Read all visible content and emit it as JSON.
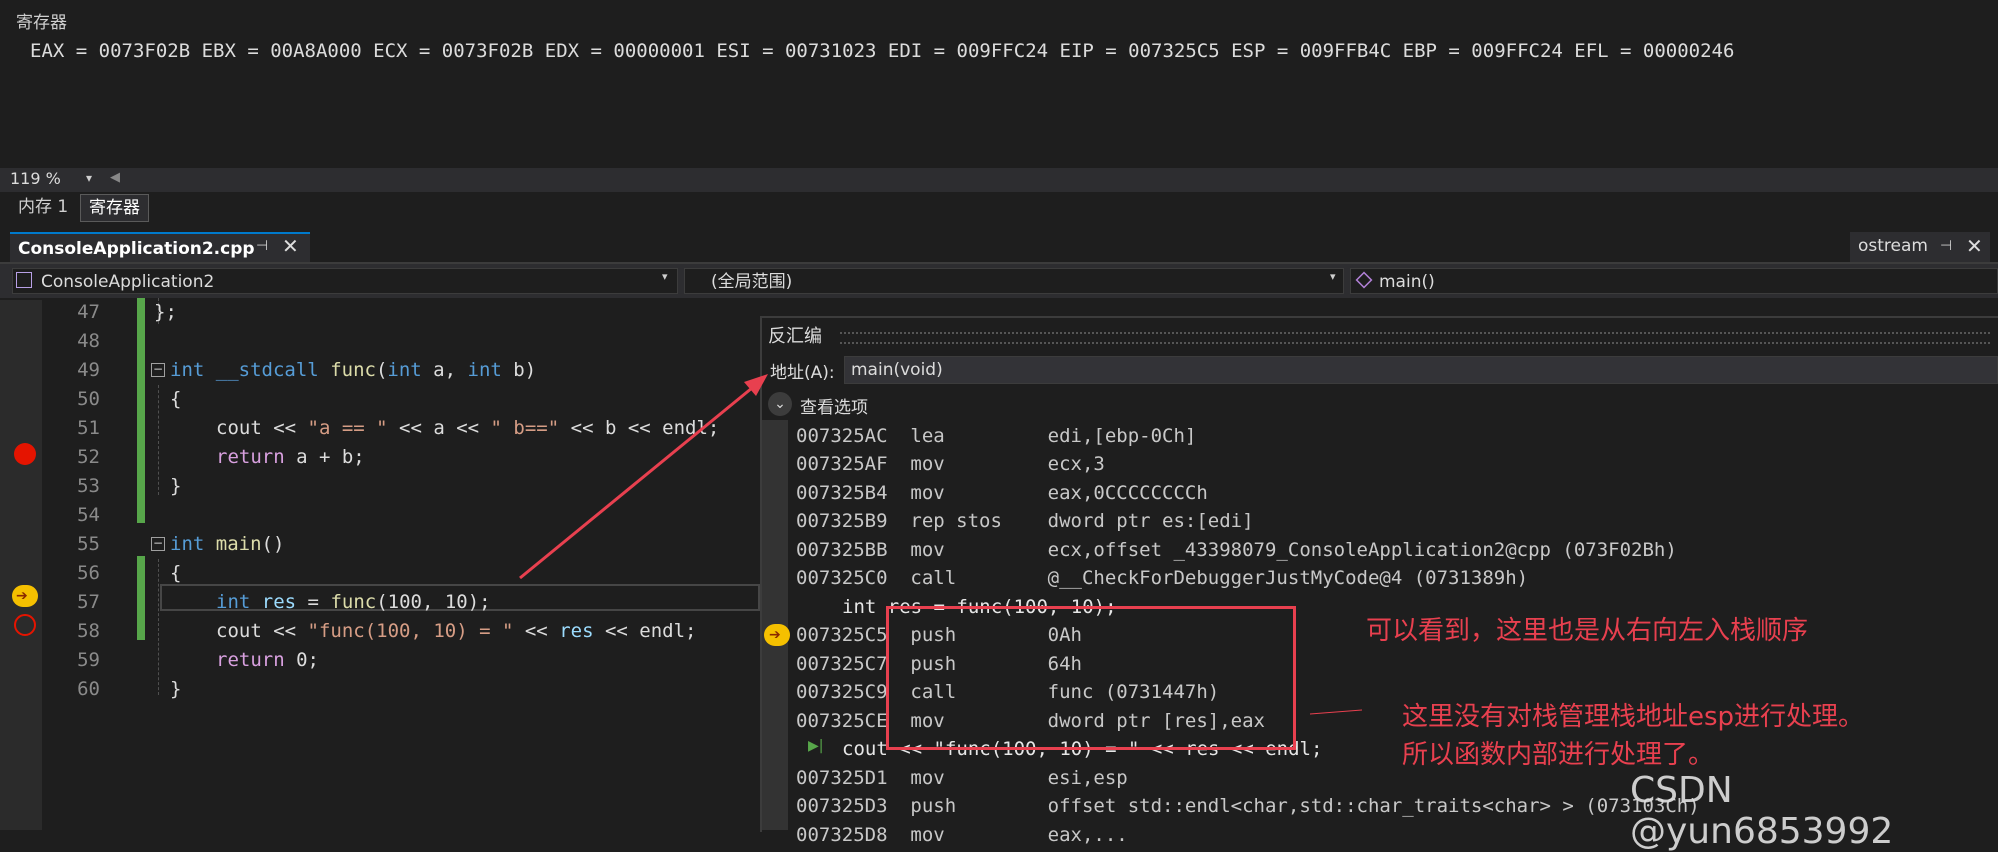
{
  "registers": {
    "title": "寄存器",
    "line": "EAX = 0073F02B EBX = 00A8A000 ECX = 0073F02B EDX = 00000001 ESI = 00731023 EDI = 009FFC24 EIP = 007325C5 ESP = 009FFB4C EBP = 009FFC24 EFL = 00000246",
    "zoom": "119 %"
  },
  "bottom_tabs": [
    "内存 1",
    "寄存器"
  ],
  "doc_tab": {
    "label": "ConsoleApplication2.cpp",
    "pin": "⊣",
    "close": "✕"
  },
  "side_tab": {
    "label": "ostream",
    "pin": "⊣",
    "close": "✕"
  },
  "nav": {
    "project": "ConsoleApplication2",
    "scope": "(全局范围)",
    "function": "main()"
  },
  "line_numbers": [
    "47",
    "48",
    "49",
    "50",
    "51",
    "52",
    "53",
    "54",
    "55",
    "56",
    "57",
    "58",
    "59",
    "60"
  ],
  "code": {
    "l47": "};",
    "l49_kw": "int",
    "l49_cc": "__stdcall",
    "l49_fn": "func",
    "l49_p1": "(",
    "l49_kw2": "int",
    "l49_a": " a, ",
    "l49_kw3": "int",
    "l49_b": " b)",
    "l50": "{",
    "l51_a": "cout << ",
    "l51_s1": "\"a == \"",
    "l51_b": " << a << ",
    "l51_s2": "\" b==\"",
    "l51_c": " << b << endl;",
    "l52_ret": "return",
    "l52_rest": " a + b;",
    "l53": "}",
    "l55_kw": "int",
    "l55_fn": "main",
    "l55_rest": "()",
    "l56": "{",
    "l57_kw": "int",
    "l57_var": "res",
    "l57_eq": " = ",
    "l57_fn": "func",
    "l57_args": "(100, 10);",
    "l58_a": "cout << ",
    "l58_s": "\"func(100, 10) = \"",
    "l58_b": " << ",
    "l58_var": "res",
    "l58_c": " << endl;",
    "l59_ret": "return",
    "l59_rest": " 0;",
    "l60": "}"
  },
  "disasm": {
    "title": "反汇编",
    "address_label": "地址(A):",
    "address_value": "main(void)",
    "view_options": "查看选项",
    "lines": [
      "007325AC  lea         edi,[ebp-0Ch]",
      "007325AF  mov         ecx,3",
      "007325B4  mov         eax,0CCCCCCCCh",
      "007325B9  rep stos    dword ptr es:[edi]",
      "007325BB  mov         ecx,offset _43398079_ConsoleApplication2@cpp (073F02Bh)",
      "007325C0  call        @__CheckForDebuggerJustMyCode@4 (0731389h)"
    ],
    "src1": "int res = func(100, 10);",
    "lines2": [
      "007325C5  push        0Ah",
      "007325C7  push        64h",
      "007325C9  call        func (0731447h)",
      "007325CE  mov         dword ptr [res],eax"
    ],
    "src2": "cout << \"func(100, 10) = \" << res << endl;",
    "lines3": [
      "007325D1  mov         esi,esp",
      "007325D3  push        offset std::endl<char,std::char_traits<char> > (073103Ch)",
      "007325D8  mov         eax,..."
    ]
  },
  "annotations": {
    "text1": "可以看到，这里也是从右向左入栈顺序",
    "text2": "这里没有对栈管理栈地址esp进行处理。",
    "text3": "所以函数内部进行处理了。"
  },
  "watermark": "CSDN @yun6853992",
  "colors": {
    "accent": "#007acc",
    "annotation": "#e8404f",
    "breakpoint": "#e51400",
    "ip": "#f5c000"
  }
}
